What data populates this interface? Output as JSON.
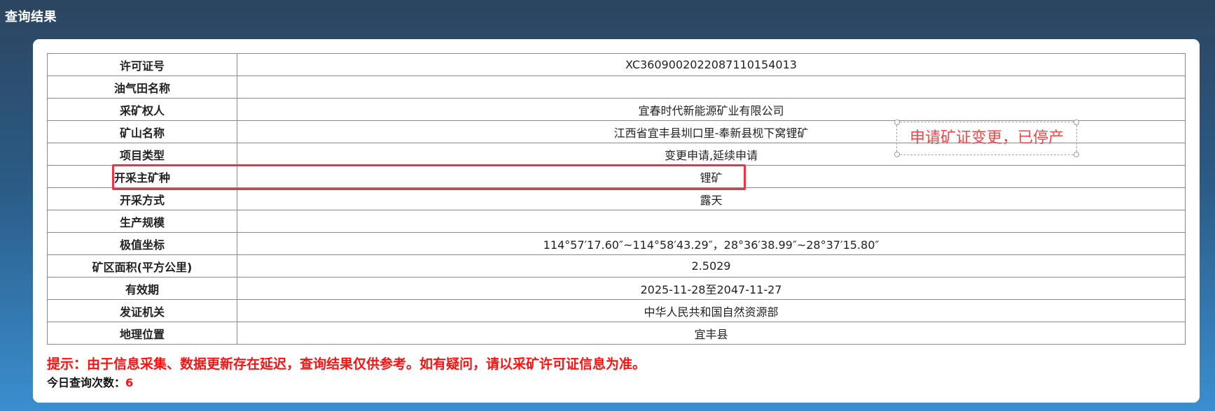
{
  "page_title": "查询结果",
  "rows": [
    {
      "label": "许可证号",
      "value": "XC3609002022087110154013"
    },
    {
      "label": "油气田名称",
      "value": ""
    },
    {
      "label": "采矿权人",
      "value": "宜春时代新能源矿业有限公司"
    },
    {
      "label": "矿山名称",
      "value": "江西省宜丰县圳口里-奉新县枧下窝锂矿"
    },
    {
      "label": "项目类型",
      "value": "变更申请,延续申请"
    },
    {
      "label": "开采主矿种",
      "value": "锂矿"
    },
    {
      "label": "开采方式",
      "value": "露天"
    },
    {
      "label": "生产规模",
      "value": ""
    },
    {
      "label": "极值坐标",
      "value": "114°57′17.60″~114°58′43.29″，28°36′38.99″~28°37′15.80″"
    },
    {
      "label": "矿区面积(平方公里)",
      "value": "2.5029"
    },
    {
      "label": "有效期",
      "value": "2025-11-28至2047-11-27"
    },
    {
      "label": "发证机关",
      "value": "中华人民共和国自然资源部"
    },
    {
      "label": "地理位置",
      "value": "宜丰县"
    }
  ],
  "annotation": {
    "text": "申请矿证变更，已停产",
    "color": "#f04848"
  },
  "highlight": {
    "row_label": "开采主矿种",
    "color": "#ee3344"
  },
  "notice": "提示：由于信息采集、数据更新存在延迟，查询结果仅供参考。如有疑问，请以采矿许可证信息为准。",
  "query_count": {
    "label": "今日查询次数：",
    "value": "6"
  }
}
